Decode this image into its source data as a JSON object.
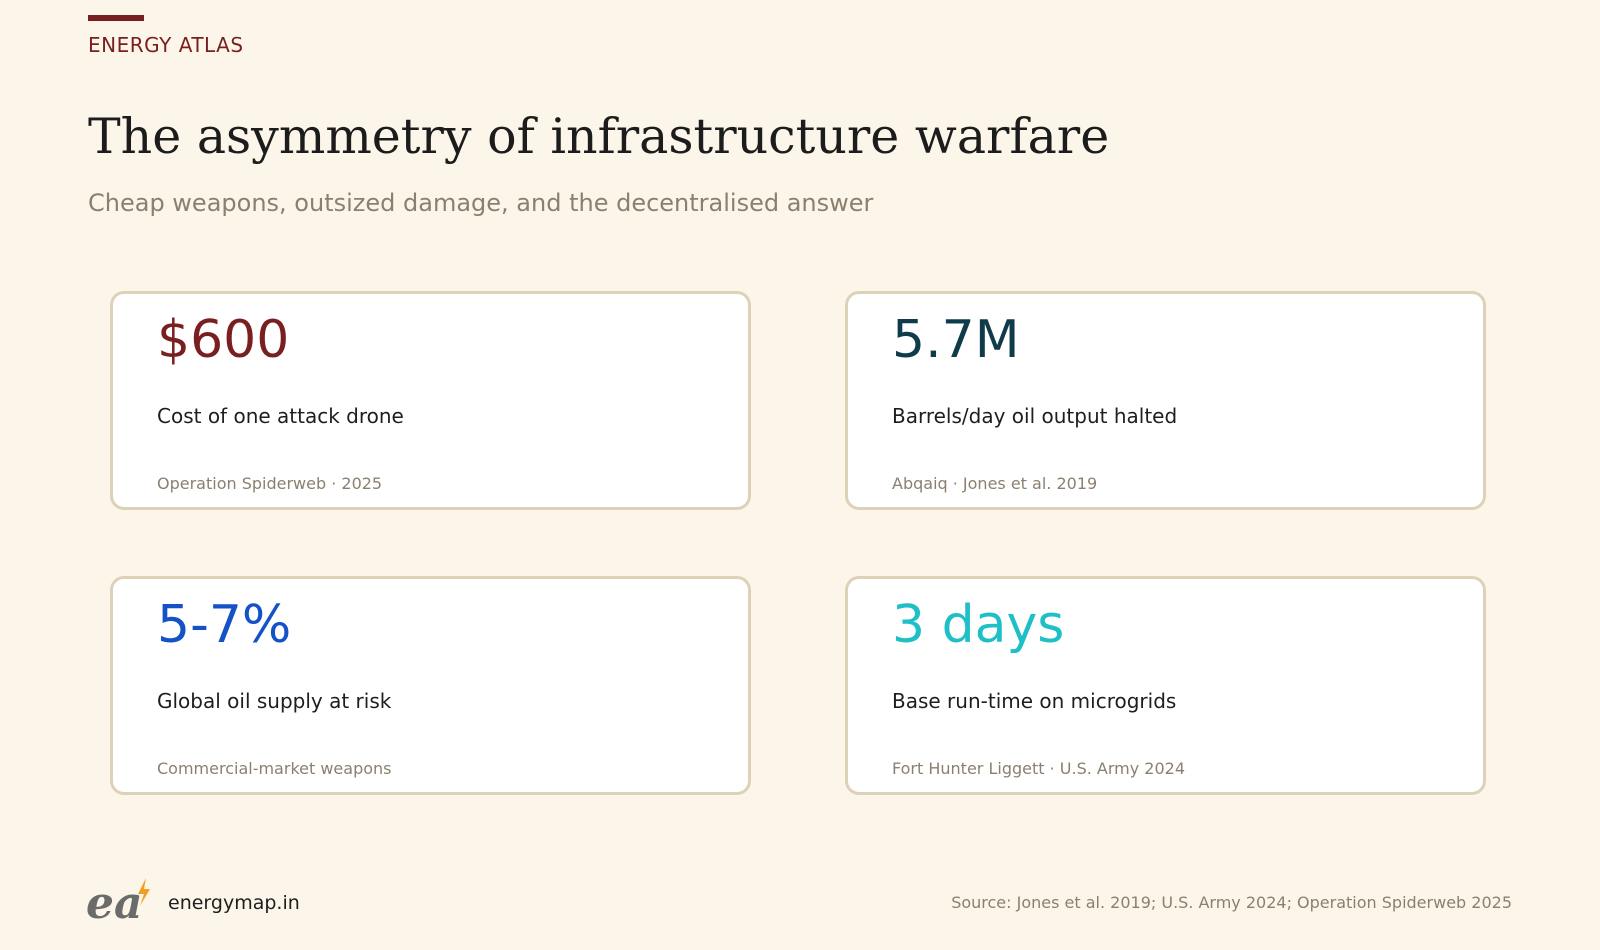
{
  "header": {
    "brand": "ENERGY ATLAS",
    "title": "The asymmetry of infrastructure warfare",
    "subtitle": "Cheap weapons, outsized damage, and the decentralised answer"
  },
  "cards": [
    {
      "value": "$600",
      "label": "Cost of one attack drone",
      "source": "Operation Spiderweb · 2025",
      "color": "#7a1f1f"
    },
    {
      "value": "5.7M",
      "label": "Barrels/day oil output halted",
      "source": "Abqaiq · Jones et al. 2019",
      "color": "#0f3b4a"
    },
    {
      "value": "5-7%",
      "label": "Global oil supply at risk",
      "source": "Commercial-market weapons",
      "color": "#1552c8"
    },
    {
      "value": "3 days",
      "label": "Base run-time on microgrids",
      "source": "Fort Hunter Liggett · U.S. Army 2024",
      "color": "#1fbfc8"
    }
  ],
  "footer": {
    "logo_text": "ea",
    "site": "energymap.in",
    "source": "Source: Jones et al. 2019; U.S. Army 2024; Operation Spiderweb 2025"
  },
  "colors": {
    "background": "#fcf6ea",
    "accent": "#7a1f1f",
    "card_border": "#ddd1b8",
    "muted_text": "#8b8070"
  }
}
